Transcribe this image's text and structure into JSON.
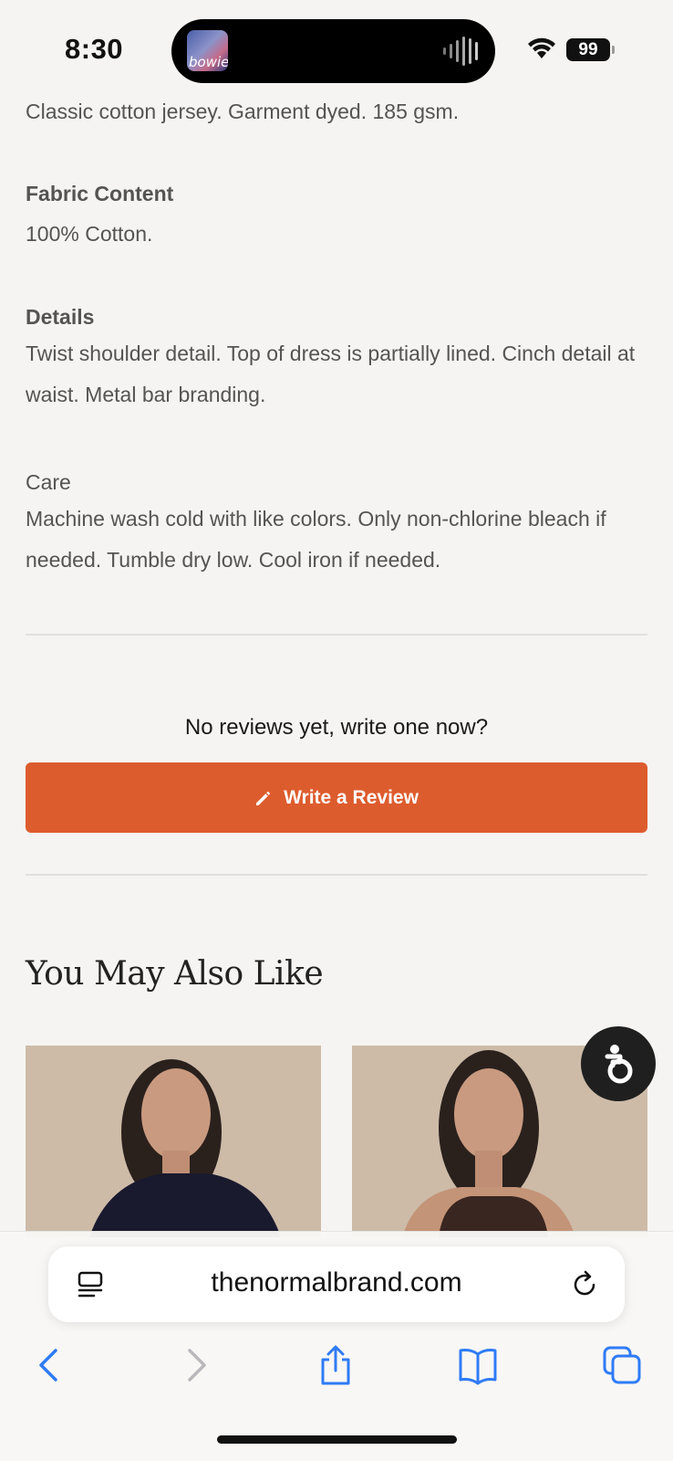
{
  "status_bar": {
    "time": "8:30",
    "battery": "99",
    "now_playing_art_text": "bowie"
  },
  "product": {
    "description": "Classic cotton jersey. Garment dyed. 185 gsm.",
    "fabric_heading": "Fabric Content",
    "fabric_text": "100% Cotton.",
    "details_heading": "Details",
    "details_text": "Twist shoulder detail. Top of dress is partially lined. Cinch detail at waist. Metal bar branding.",
    "care_label": "Care",
    "care_text": "Machine wash cold with like colors. Only non-chlorine bleach if needed. Tumble dry low. Cool iron if needed."
  },
  "reviews": {
    "prompt": "No reviews yet, write one now?",
    "button_label": "Write a Review",
    "button_color": "#dd5c2e"
  },
  "recommendations": {
    "title": "You May Also Like"
  },
  "browser": {
    "url": "thenormalbrand.com",
    "accent_color": "#2f7bf6"
  }
}
